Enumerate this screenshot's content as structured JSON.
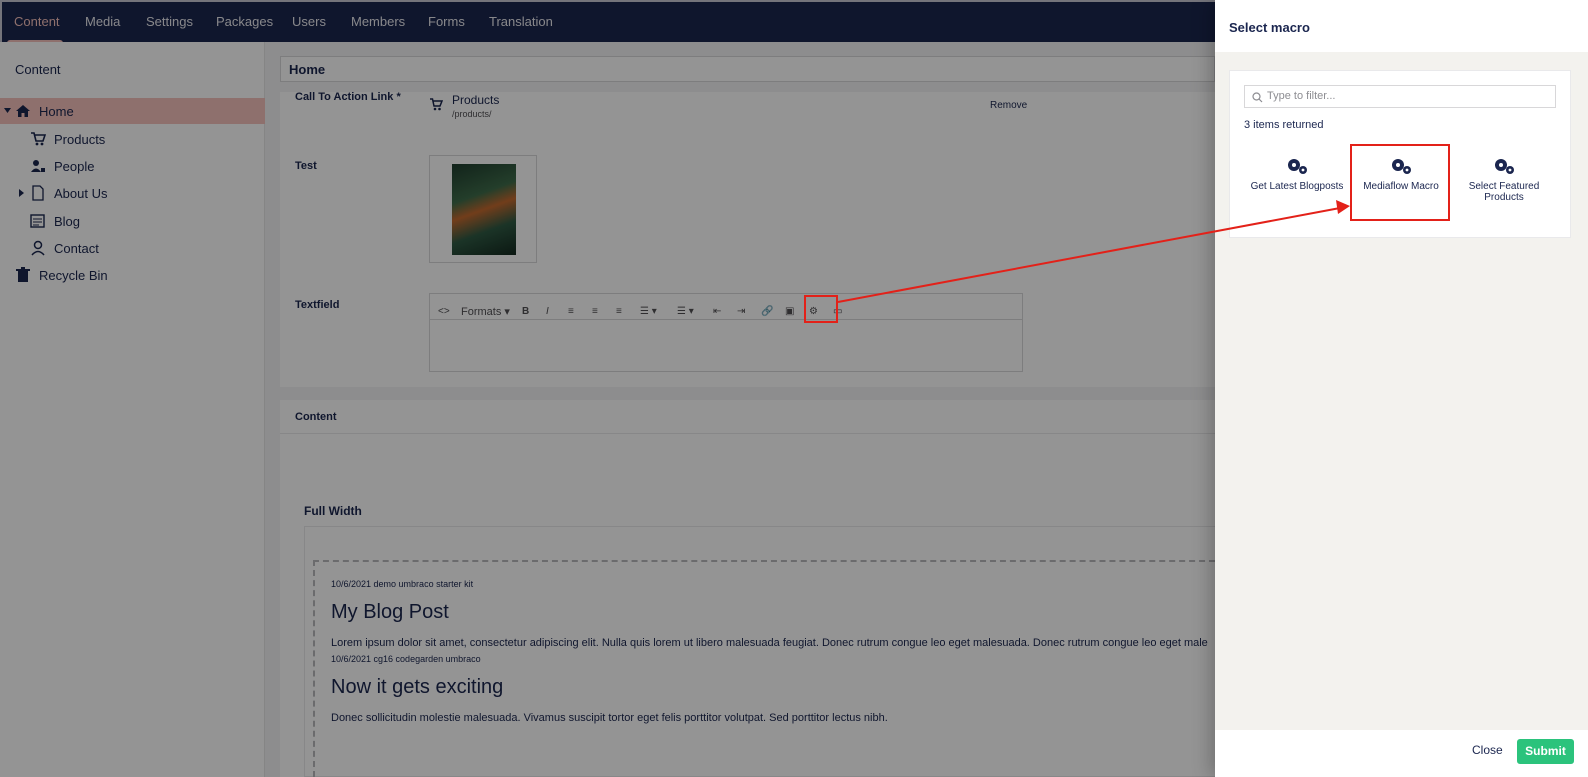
{
  "nav": {
    "items": [
      "Content",
      "Media",
      "Settings",
      "Packages",
      "Users",
      "Members",
      "Forms",
      "Translation"
    ],
    "active": "Content"
  },
  "sidebar": {
    "title": "Content",
    "items": [
      {
        "label": "Home",
        "icon": "home-icon"
      },
      {
        "label": "Products",
        "icon": "cart-icon"
      },
      {
        "label": "People",
        "icon": "people-icon"
      },
      {
        "label": "About Us",
        "icon": "document-icon"
      },
      {
        "label": "Blog",
        "icon": "blog-icon"
      },
      {
        "label": "Contact",
        "icon": "contact-icon"
      },
      {
        "label": "Recycle Bin",
        "icon": "trash-icon"
      }
    ]
  },
  "editor": {
    "doc_name": "Home",
    "cta_label": "Call To Action Link",
    "cta_link_name": "Products",
    "cta_link_url": "/products/",
    "cta_remove": "Remove",
    "test_label": "Test",
    "textfield_label": "Textfield",
    "formats_label": "Formats",
    "content_label": "Content",
    "full_width_label": "Full Width",
    "posts": [
      {
        "meta": "10/6/2021 demo umbraco starter kit",
        "title": "My Blog Post",
        "excerpt": "Lorem ipsum dolor sit amet, consectetur adipiscing elit. Nulla quis lorem ut libero malesuada feugiat. Donec rutrum congue leo eget malesuada. Donec rutrum congue leo eget male"
      },
      {
        "meta": "10/6/2021 cg16 codegarden umbraco",
        "title": "Now it gets exciting",
        "excerpt": "Donec sollicitudin molestie malesuada. Vivamus suscipit tortor eget felis porttitor volutpat. Sed porttitor lectus nibh."
      }
    ]
  },
  "dialog": {
    "title": "Select macro",
    "filter_placeholder": "Type to filter...",
    "count_text": "3 items returned",
    "macros": [
      "Get Latest Blogposts",
      "Mediaflow Macro",
      "Select Featured Products"
    ],
    "close_label": "Close",
    "submit_label": "Submit"
  },
  "colors": {
    "nav_bg": "#1b264f",
    "accent": "#f5c1bc",
    "submit": "#2bc37c",
    "highlight": "#e32119"
  }
}
